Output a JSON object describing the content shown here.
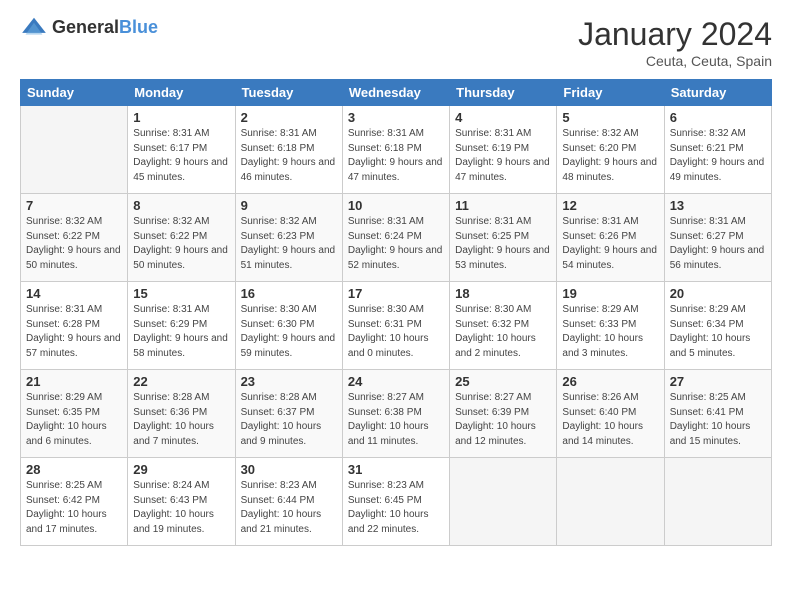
{
  "header": {
    "logo": {
      "general": "General",
      "blue": "Blue"
    },
    "title": "January 2024",
    "subtitle": "Ceuta, Ceuta, Spain"
  },
  "calendar": {
    "days_of_week": [
      "Sunday",
      "Monday",
      "Tuesday",
      "Wednesday",
      "Thursday",
      "Friday",
      "Saturday"
    ],
    "weeks": [
      [
        {
          "day": "",
          "sunrise": "",
          "sunset": "",
          "daylight": ""
        },
        {
          "day": "1",
          "sunrise": "Sunrise: 8:31 AM",
          "sunset": "Sunset: 6:17 PM",
          "daylight": "Daylight: 9 hours and 45 minutes."
        },
        {
          "day": "2",
          "sunrise": "Sunrise: 8:31 AM",
          "sunset": "Sunset: 6:18 PM",
          "daylight": "Daylight: 9 hours and 46 minutes."
        },
        {
          "day": "3",
          "sunrise": "Sunrise: 8:31 AM",
          "sunset": "Sunset: 6:18 PM",
          "daylight": "Daylight: 9 hours and 47 minutes."
        },
        {
          "day": "4",
          "sunrise": "Sunrise: 8:31 AM",
          "sunset": "Sunset: 6:19 PM",
          "daylight": "Daylight: 9 hours and 47 minutes."
        },
        {
          "day": "5",
          "sunrise": "Sunrise: 8:32 AM",
          "sunset": "Sunset: 6:20 PM",
          "daylight": "Daylight: 9 hours and 48 minutes."
        },
        {
          "day": "6",
          "sunrise": "Sunrise: 8:32 AM",
          "sunset": "Sunset: 6:21 PM",
          "daylight": "Daylight: 9 hours and 49 minutes."
        }
      ],
      [
        {
          "day": "7",
          "sunrise": "Sunrise: 8:32 AM",
          "sunset": "Sunset: 6:22 PM",
          "daylight": "Daylight: 9 hours and 50 minutes."
        },
        {
          "day": "8",
          "sunrise": "Sunrise: 8:32 AM",
          "sunset": "Sunset: 6:22 PM",
          "daylight": "Daylight: 9 hours and 50 minutes."
        },
        {
          "day": "9",
          "sunrise": "Sunrise: 8:32 AM",
          "sunset": "Sunset: 6:23 PM",
          "daylight": "Daylight: 9 hours and 51 minutes."
        },
        {
          "day": "10",
          "sunrise": "Sunrise: 8:31 AM",
          "sunset": "Sunset: 6:24 PM",
          "daylight": "Daylight: 9 hours and 52 minutes."
        },
        {
          "day": "11",
          "sunrise": "Sunrise: 8:31 AM",
          "sunset": "Sunset: 6:25 PM",
          "daylight": "Daylight: 9 hours and 53 minutes."
        },
        {
          "day": "12",
          "sunrise": "Sunrise: 8:31 AM",
          "sunset": "Sunset: 6:26 PM",
          "daylight": "Daylight: 9 hours and 54 minutes."
        },
        {
          "day": "13",
          "sunrise": "Sunrise: 8:31 AM",
          "sunset": "Sunset: 6:27 PM",
          "daylight": "Daylight: 9 hours and 56 minutes."
        }
      ],
      [
        {
          "day": "14",
          "sunrise": "Sunrise: 8:31 AM",
          "sunset": "Sunset: 6:28 PM",
          "daylight": "Daylight: 9 hours and 57 minutes."
        },
        {
          "day": "15",
          "sunrise": "Sunrise: 8:31 AM",
          "sunset": "Sunset: 6:29 PM",
          "daylight": "Daylight: 9 hours and 58 minutes."
        },
        {
          "day": "16",
          "sunrise": "Sunrise: 8:30 AM",
          "sunset": "Sunset: 6:30 PM",
          "daylight": "Daylight: 9 hours and 59 minutes."
        },
        {
          "day": "17",
          "sunrise": "Sunrise: 8:30 AM",
          "sunset": "Sunset: 6:31 PM",
          "daylight": "Daylight: 10 hours and 0 minutes."
        },
        {
          "day": "18",
          "sunrise": "Sunrise: 8:30 AM",
          "sunset": "Sunset: 6:32 PM",
          "daylight": "Daylight: 10 hours and 2 minutes."
        },
        {
          "day": "19",
          "sunrise": "Sunrise: 8:29 AM",
          "sunset": "Sunset: 6:33 PM",
          "daylight": "Daylight: 10 hours and 3 minutes."
        },
        {
          "day": "20",
          "sunrise": "Sunrise: 8:29 AM",
          "sunset": "Sunset: 6:34 PM",
          "daylight": "Daylight: 10 hours and 5 minutes."
        }
      ],
      [
        {
          "day": "21",
          "sunrise": "Sunrise: 8:29 AM",
          "sunset": "Sunset: 6:35 PM",
          "daylight": "Daylight: 10 hours and 6 minutes."
        },
        {
          "day": "22",
          "sunrise": "Sunrise: 8:28 AM",
          "sunset": "Sunset: 6:36 PM",
          "daylight": "Daylight: 10 hours and 7 minutes."
        },
        {
          "day": "23",
          "sunrise": "Sunrise: 8:28 AM",
          "sunset": "Sunset: 6:37 PM",
          "daylight": "Daylight: 10 hours and 9 minutes."
        },
        {
          "day": "24",
          "sunrise": "Sunrise: 8:27 AM",
          "sunset": "Sunset: 6:38 PM",
          "daylight": "Daylight: 10 hours and 11 minutes."
        },
        {
          "day": "25",
          "sunrise": "Sunrise: 8:27 AM",
          "sunset": "Sunset: 6:39 PM",
          "daylight": "Daylight: 10 hours and 12 minutes."
        },
        {
          "day": "26",
          "sunrise": "Sunrise: 8:26 AM",
          "sunset": "Sunset: 6:40 PM",
          "daylight": "Daylight: 10 hours and 14 minutes."
        },
        {
          "day": "27",
          "sunrise": "Sunrise: 8:25 AM",
          "sunset": "Sunset: 6:41 PM",
          "daylight": "Daylight: 10 hours and 15 minutes."
        }
      ],
      [
        {
          "day": "28",
          "sunrise": "Sunrise: 8:25 AM",
          "sunset": "Sunset: 6:42 PM",
          "daylight": "Daylight: 10 hours and 17 minutes."
        },
        {
          "day": "29",
          "sunrise": "Sunrise: 8:24 AM",
          "sunset": "Sunset: 6:43 PM",
          "daylight": "Daylight: 10 hours and 19 minutes."
        },
        {
          "day": "30",
          "sunrise": "Sunrise: 8:23 AM",
          "sunset": "Sunset: 6:44 PM",
          "daylight": "Daylight: 10 hours and 21 minutes."
        },
        {
          "day": "31",
          "sunrise": "Sunrise: 8:23 AM",
          "sunset": "Sunset: 6:45 PM",
          "daylight": "Daylight: 10 hours and 22 minutes."
        },
        {
          "day": "",
          "sunrise": "",
          "sunset": "",
          "daylight": ""
        },
        {
          "day": "",
          "sunrise": "",
          "sunset": "",
          "daylight": ""
        },
        {
          "day": "",
          "sunrise": "",
          "sunset": "",
          "daylight": ""
        }
      ]
    ]
  }
}
